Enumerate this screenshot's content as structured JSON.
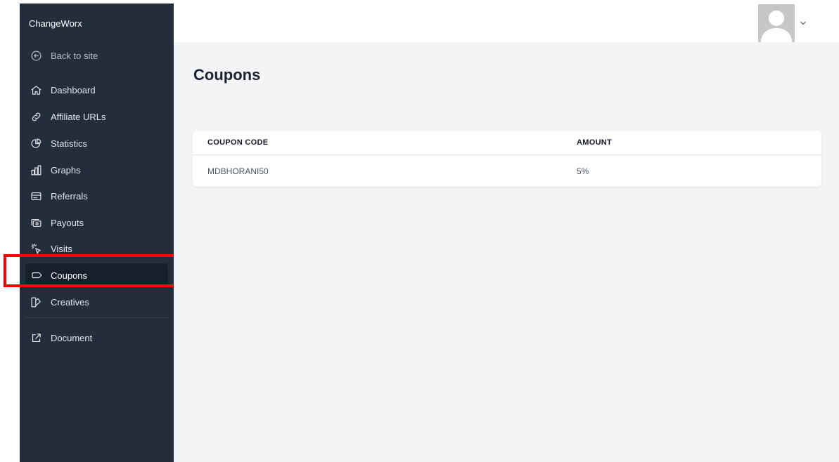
{
  "sidebar": {
    "brand": "ChangeWorx",
    "back": {
      "label": "Back to site",
      "icon": "back-arrow-circle-icon"
    },
    "items": [
      {
        "label": "Dashboard",
        "icon": "home-icon"
      },
      {
        "label": "Affiliate URLs",
        "icon": "link-icon"
      },
      {
        "label": "Statistics",
        "icon": "pie-chart-icon"
      },
      {
        "label": "Graphs",
        "icon": "bar-chart-icon"
      },
      {
        "label": "Referrals",
        "icon": "credit-card-icon"
      },
      {
        "label": "Payouts",
        "icon": "cash-icon"
      },
      {
        "label": "Visits",
        "icon": "cursor-click-icon"
      },
      {
        "label": "Coupons",
        "icon": "tag-icon",
        "active": true
      },
      {
        "label": "Creatives",
        "icon": "swatch-icon"
      }
    ],
    "external": {
      "label": "Document",
      "icon": "external-link-icon"
    }
  },
  "header": {
    "avatar_icon": "user-avatar-icon",
    "menu_icon": "chevron-down-icon"
  },
  "page": {
    "title": "Coupons"
  },
  "table": {
    "columns": [
      "COUPON CODE",
      "AMOUNT"
    ],
    "rows": [
      [
        "MDBHORANI50",
        "5%"
      ]
    ]
  },
  "colors": {
    "sidebar": "#232d3b",
    "active_item": "#171f2b",
    "main_bg": "#f3f4f6",
    "highlight": "#ff0000"
  }
}
